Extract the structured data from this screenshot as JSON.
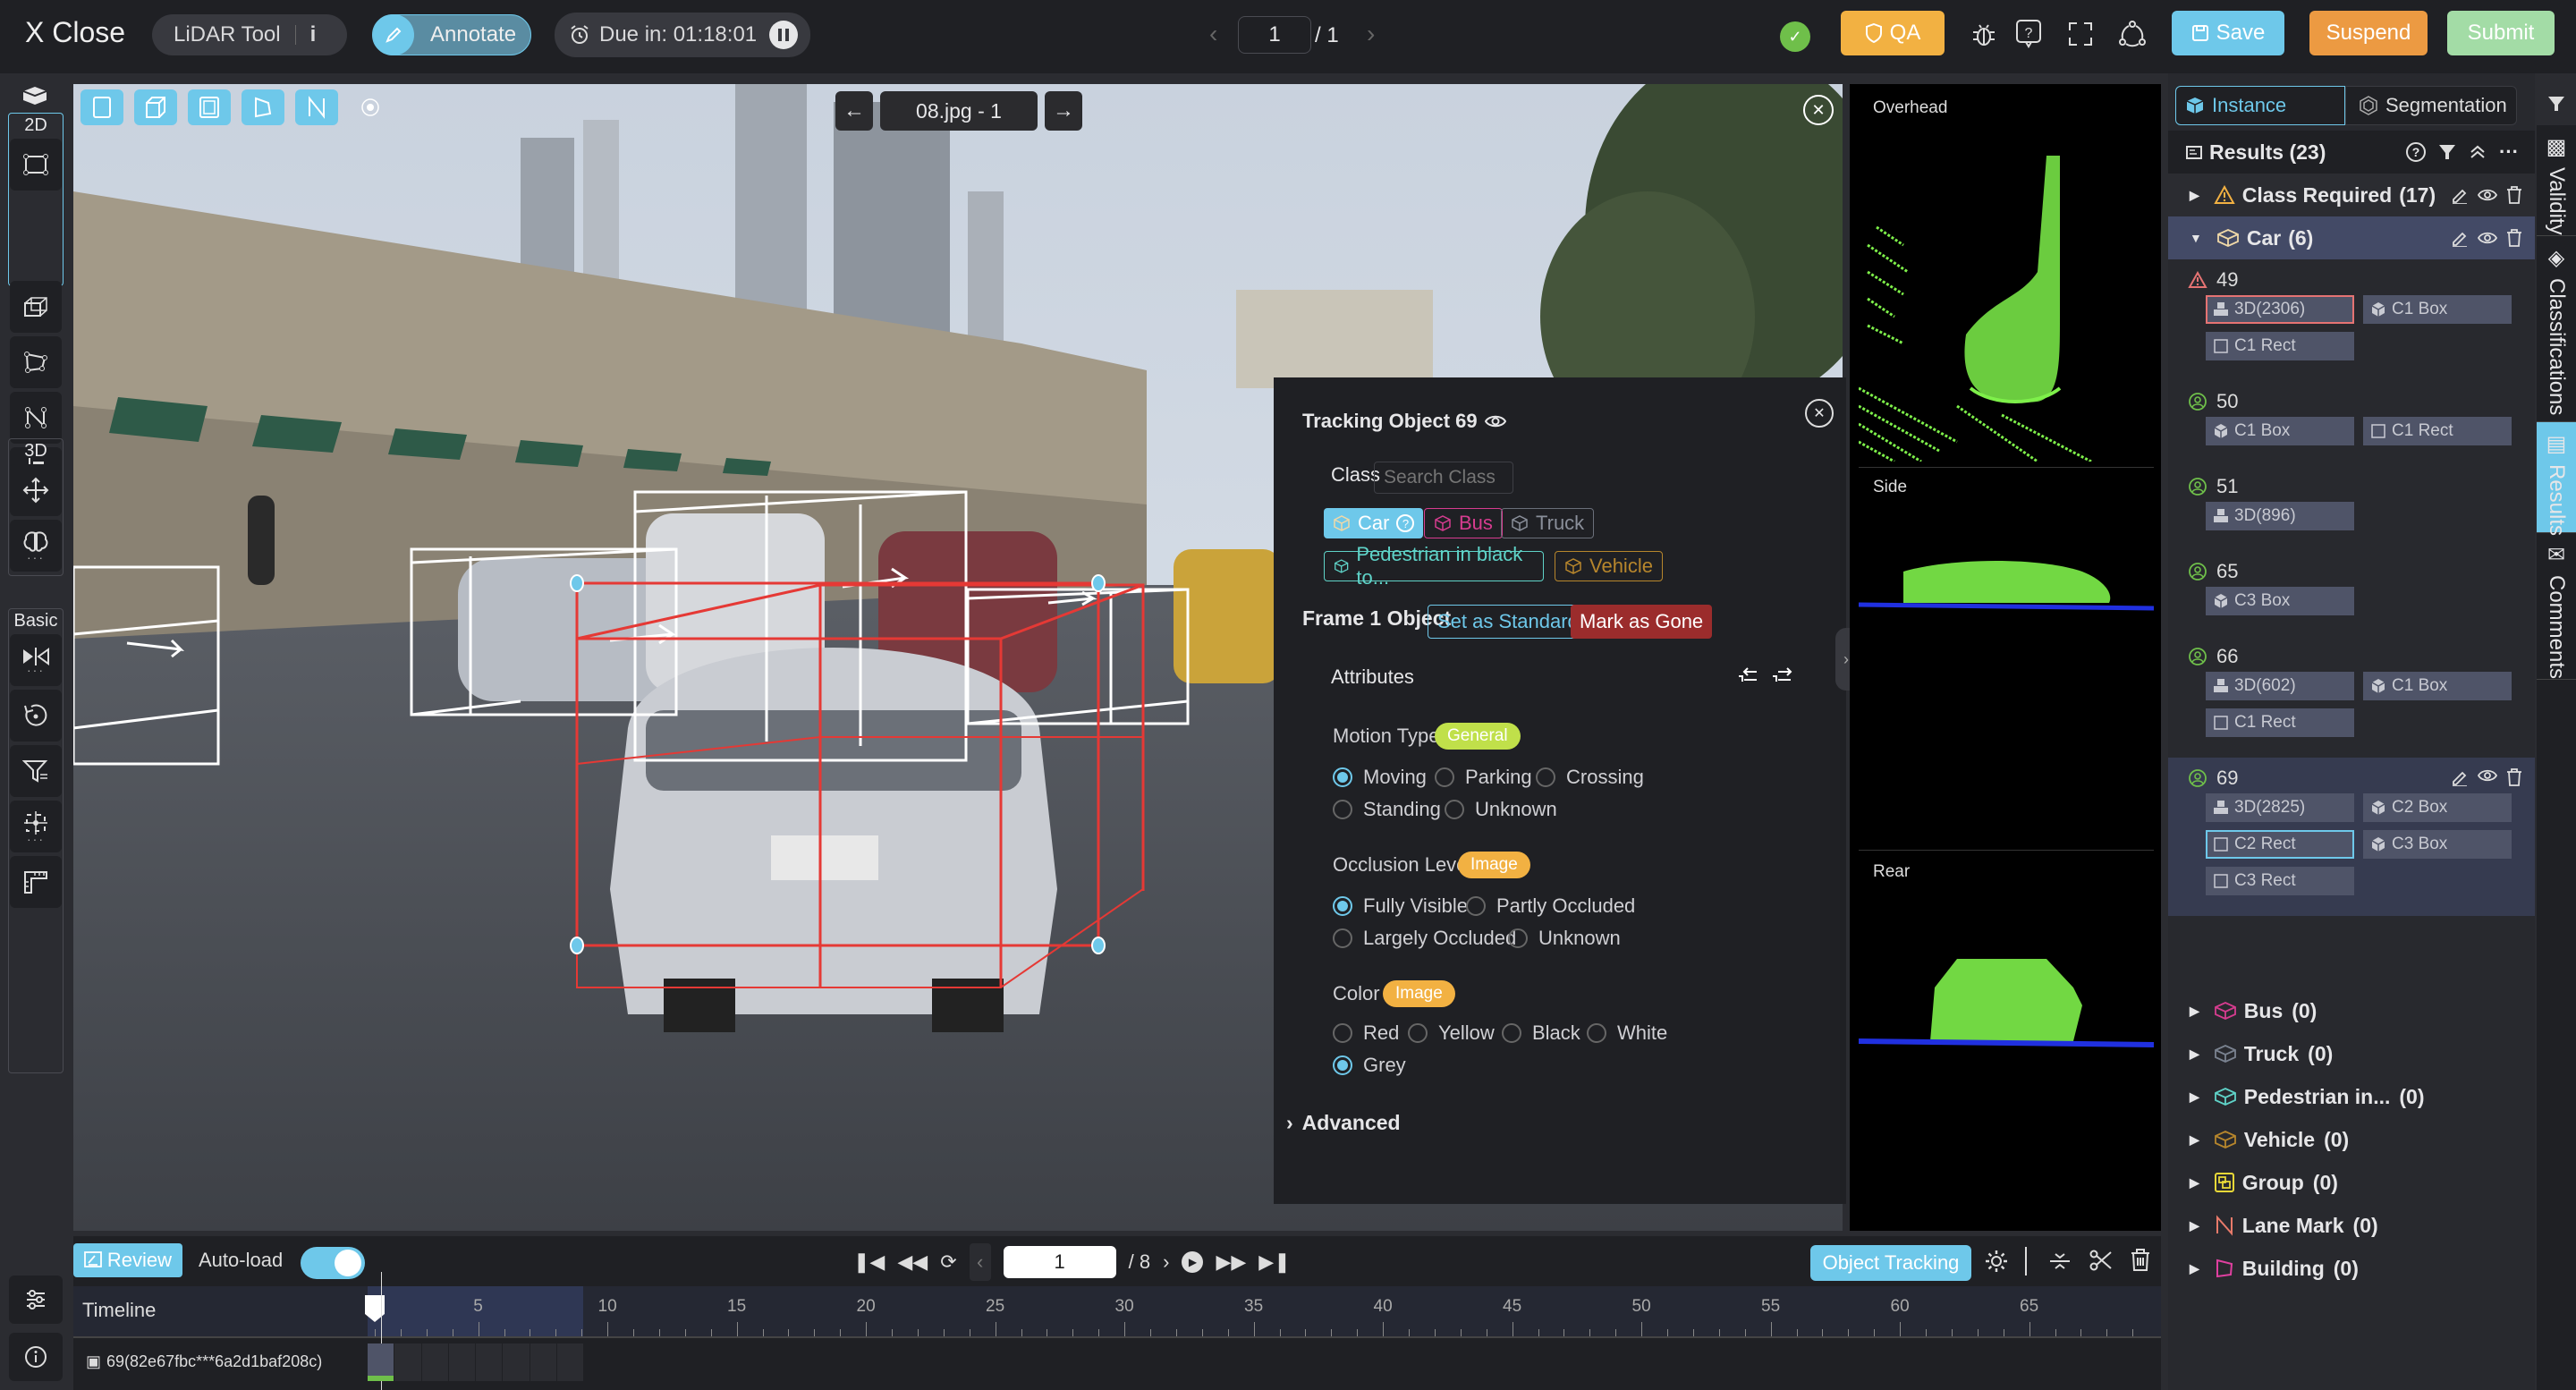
{
  "topbar": {
    "close_label": "X Close",
    "tool_label": "LiDAR Tool",
    "mode_label": "Annotate",
    "due_label": "Due in: 01:18:01",
    "page_current": "1",
    "page_total": "/ 1",
    "qa_label": "QA",
    "save_label": "Save",
    "suspend_label": "Suspend",
    "submit_label": "Submit"
  },
  "left_toolbar": {
    "groups": [
      {
        "label": "2D"
      },
      {
        "label": "3D"
      },
      {
        "label": "Basic"
      }
    ]
  },
  "canvas": {
    "file_label": "08.jpg - 1"
  },
  "views": {
    "overhead": "Overhead",
    "side": "Side",
    "rear": "Rear"
  },
  "popup": {
    "title": "Tracking Object 69",
    "class_label": "Class",
    "search_placeholder": "Search Class",
    "classes": [
      {
        "label": "Car",
        "color": "#6ec8ea",
        "selected": true
      },
      {
        "label": "Bus",
        "color": "#d63c8f"
      },
      {
        "label": "Truck",
        "color": "#8a8f9a"
      },
      {
        "label": "Pedestrian in black to...",
        "color": "#5fd3c8"
      },
      {
        "label": "Vehicle",
        "color": "#b7862c"
      }
    ],
    "frame_label": "Frame 1 Object",
    "set_standard_label": "Set as Standard",
    "mark_gone_label": "Mark as Gone",
    "attributes_label": "Attributes",
    "motion": {
      "label": "Motion Type",
      "badge": "General",
      "options": [
        "Moving",
        "Parking",
        "Crossing",
        "Standing",
        "Unknown"
      ],
      "selected": "Moving"
    },
    "occlusion": {
      "label": "Occlusion Level",
      "badge": "Image",
      "options": [
        "Fully Visible",
        "Partly Occluded",
        "Largely Occluded",
        "Unknown"
      ],
      "selected": "Fully Visible"
    },
    "color": {
      "label": "Color",
      "badge": "Image",
      "options": [
        "Red",
        "Yellow",
        "Black",
        "White",
        "Grey"
      ],
      "selected": "Grey"
    },
    "advanced_label": "Advanced"
  },
  "right_panel": {
    "tab_instance": "Instance",
    "tab_segmentation": "Segmentation",
    "results_label": "Results (23)",
    "class_required": {
      "label": "Class Required",
      "count": "(17)"
    },
    "car": {
      "label": "Car",
      "count": "(6)"
    },
    "objects": [
      {
        "id": "49",
        "status": "warning",
        "chips": [
          {
            "icon": "3d",
            "label": "3D(2306)",
            "hl": "red"
          },
          {
            "icon": "box",
            "label": "C1 Box"
          },
          {
            "icon": "rect",
            "label": "C1 Rect"
          }
        ]
      },
      {
        "id": "50",
        "status": "ok",
        "chips": [
          {
            "icon": "box",
            "label": "C1 Box"
          },
          {
            "icon": "rect",
            "label": "C1 Rect"
          }
        ]
      },
      {
        "id": "51",
        "status": "ok",
        "chips": [
          {
            "icon": "3d",
            "label": "3D(896)"
          }
        ]
      },
      {
        "id": "65",
        "status": "ok",
        "chips": [
          {
            "icon": "box",
            "label": "C3 Box"
          }
        ]
      },
      {
        "id": "66",
        "status": "ok",
        "chips": [
          {
            "icon": "3d",
            "label": "3D(602)"
          },
          {
            "icon": "box",
            "label": "C1 Box"
          },
          {
            "icon": "rect",
            "label": "C1 Rect"
          }
        ]
      },
      {
        "id": "69",
        "status": "ok",
        "selected": true,
        "chips": [
          {
            "icon": "3d",
            "label": "3D(2825)"
          },
          {
            "icon": "box",
            "label": "C2 Box"
          },
          {
            "icon": "rect",
            "label": "C2 Rect",
            "hl": "blue"
          },
          {
            "icon": "box",
            "label": "C3 Box"
          },
          {
            "icon": "rect",
            "label": "C3 Rect"
          }
        ]
      }
    ],
    "other_classes": [
      {
        "label": "Bus",
        "count": "(0)",
        "color": "#d63c8f",
        "icon": "cube"
      },
      {
        "label": "Truck",
        "count": "(0)",
        "color": "#7a8290",
        "icon": "cube"
      },
      {
        "label": "Pedestrian in...",
        "count": "(0)",
        "color": "#5fd3c8",
        "icon": "cube"
      },
      {
        "label": "Vehicle",
        "count": "(0)",
        "color": "#b7862c",
        "icon": "cube"
      },
      {
        "label": "Group",
        "count": "(0)",
        "color": "#e8d838",
        "icon": "group"
      },
      {
        "label": "Lane Mark",
        "count": "(0)",
        "color": "#e87a6a",
        "icon": "polyline"
      },
      {
        "label": "Building",
        "count": "(0)",
        "color": "#e040a0",
        "icon": "polygon"
      }
    ]
  },
  "side_tabs": [
    "Validity",
    "Classifications",
    "Results",
    "Comments"
  ],
  "side_tabs_active": "Results",
  "bottom": {
    "review_label": "Review",
    "autoload_label": "Auto-load",
    "autoload_on": true,
    "frame_current": "1",
    "frame_total": "/ 8",
    "object_tracking_label": "Object Tracking",
    "timeline_label": "Timeline",
    "ticks": [
      "5",
      "10",
      "15",
      "20",
      "25",
      "30",
      "35",
      "40",
      "45",
      "50",
      "55",
      "60",
      "65"
    ],
    "track_label": "69(82e67fbc***6a2d1baf208c)"
  },
  "colors": {
    "accent": "#6ec8ea",
    "qa": "#f2b142",
    "suspend": "#ec9a42",
    "submit": "#a3dca6",
    "mark_gone": "#9b2c2c",
    "selected_row": "#434a66",
    "ok_green": "#6fbf4a"
  }
}
